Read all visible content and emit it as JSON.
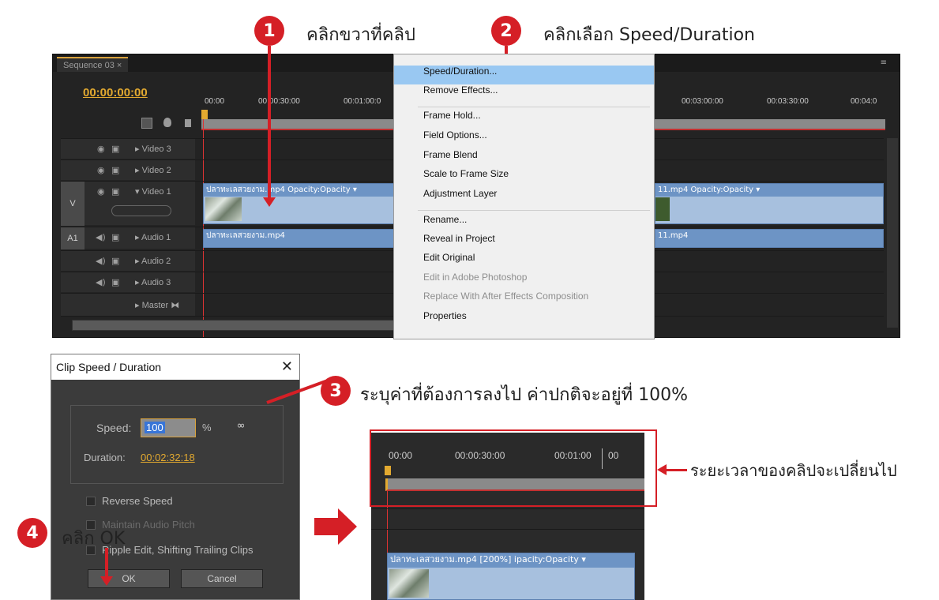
{
  "callouts": {
    "step1": {
      "num": "1",
      "text": "คลิกขวาที่คลิป"
    },
    "step2": {
      "num": "2",
      "text": "คลิกเลือก Speed/Duration"
    },
    "step3": {
      "num": "3",
      "text": "ระบุค่าที่ต้องการลงไป ค่าปกติจะอยู่ที่ 100%"
    },
    "step4": {
      "num": "4",
      "text": "คลิก OK"
    },
    "duration_note": "ระยะเวลาของคลิปจะเปลี่ยนไป"
  },
  "colors": {
    "badge": "#d51f26",
    "timecode": "#e2a930",
    "clip": "#a7c0de",
    "menu_highlight": "#99c8f2"
  },
  "timeline": {
    "tab": "Sequence 03",
    "timecode": "00:00:00:00",
    "ruler_left": [
      "00:00",
      "00:00:30:00",
      "00:01:00:0"
    ],
    "ruler_right": [
      "00:03:00:00",
      "00:03:30:00",
      "00:04:0"
    ],
    "tracks": {
      "video3": "Video 3",
      "video2": "Video 2",
      "video1": "Video 1",
      "audio1": "Audio 1",
      "audio2": "Audio 2",
      "audio3": "Audio 3",
      "master": "Master"
    },
    "target_v": "V",
    "target_a": "A1",
    "video_clip_left": "ปลาทะเลสวยงาม.mp4  Opacity:Opacity ▾",
    "video_clip_right": "11.mp4  Opacity:Opacity ▾",
    "audio_clip_left": "ปลาทะเลสวยงาม.mp4",
    "audio_clip_right": "11.mp4"
  },
  "context_menu": {
    "items": [
      {
        "label": "Speed/Duration...",
        "state": "highlighted"
      },
      {
        "label": "Remove Effects...",
        "state": "enabled"
      },
      {
        "label": "Frame Hold...",
        "state": "enabled"
      },
      {
        "label": "Field Options...",
        "state": "enabled"
      },
      {
        "label": "Frame Blend",
        "state": "enabled"
      },
      {
        "label": "Scale to Frame Size",
        "state": "enabled"
      },
      {
        "label": "Adjustment Layer",
        "state": "enabled"
      },
      {
        "label": "Rename...",
        "state": "enabled"
      },
      {
        "label": "Reveal in Project",
        "state": "enabled"
      },
      {
        "label": "Edit Original",
        "state": "enabled"
      },
      {
        "label": "Edit in Adobe Photoshop",
        "state": "disabled"
      },
      {
        "label": "Replace With After Effects Composition",
        "state": "disabled"
      },
      {
        "label": "Properties",
        "state": "enabled"
      }
    ]
  },
  "dialog": {
    "title": "Clip Speed / Duration",
    "close": "✕",
    "speed_label": "Speed:",
    "speed_value": "100",
    "percent": "%",
    "duration_label": "Duration:",
    "duration_value": "00:02:32:18",
    "reverse_speed": "Reverse Speed",
    "maintain_pitch": "Maintain Audio Pitch",
    "ripple_edit": "Ripple Edit, Shifting Trailing Clips",
    "ok": "OK",
    "cancel": "Cancel"
  },
  "zoomed": {
    "ruler": [
      "00:00",
      "00:00:30:00",
      "00:01:00",
      "00"
    ],
    "clip_label": "ปลาทะเลสวยงาม.mp4 [200%]",
    "clip_effect": "ipacity:Opacity ▾"
  }
}
